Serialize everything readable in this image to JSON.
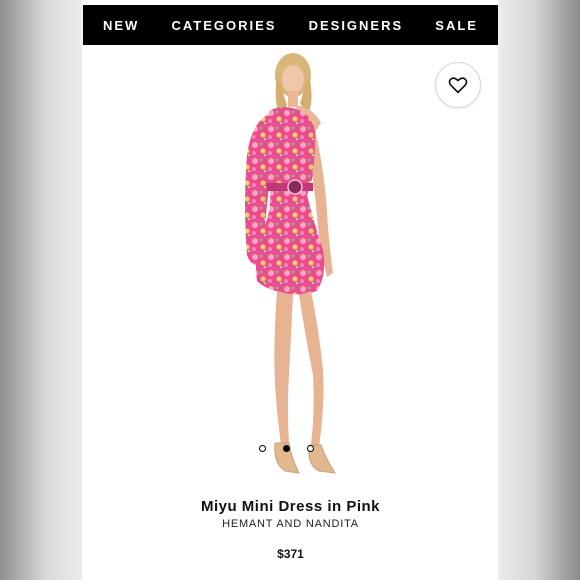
{
  "nav": {
    "items": [
      {
        "label": "NEW"
      },
      {
        "label": "CATEGORIES"
      },
      {
        "label": "DESIGNERS"
      },
      {
        "label": "SALE"
      }
    ]
  },
  "icons": {
    "wishlist": "heart-icon"
  },
  "gallery": {
    "dots_total": 3,
    "active_index": 1
  },
  "product": {
    "name": "Miyu Mini Dress in Pink",
    "designer": "HEMANT AND NANDITA",
    "price": "$371"
  },
  "colors": {
    "nav_bg": "#000000",
    "dress_pink": "#ec4b8e"
  }
}
